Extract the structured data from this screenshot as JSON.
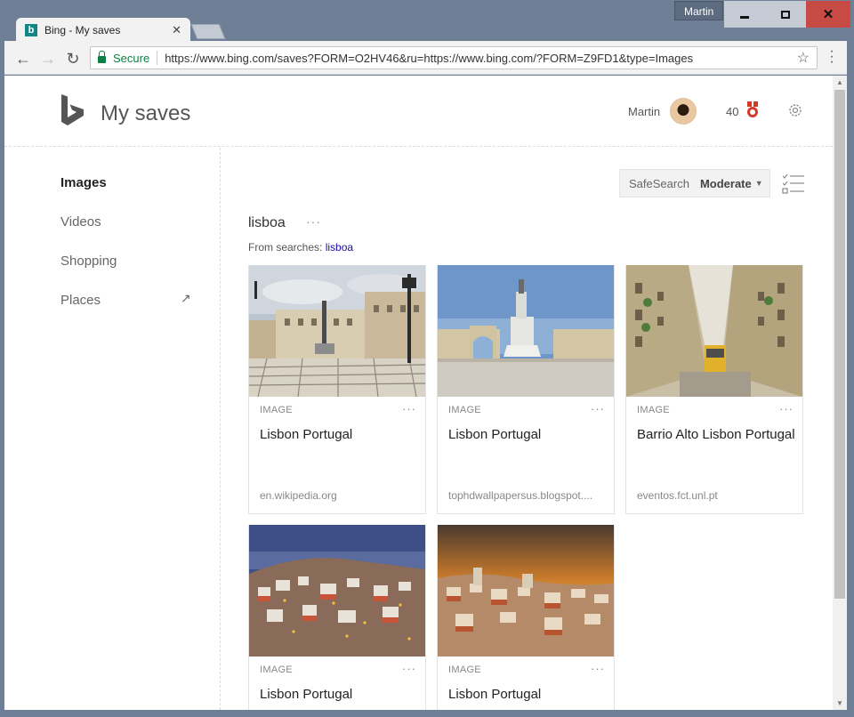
{
  "window": {
    "user_chip": "Martin"
  },
  "tab": {
    "title": "Bing - My saves",
    "favicon": "b"
  },
  "address_bar": {
    "secure_label": "Secure",
    "url": "https://www.bing.com/saves?FORM=O2HV46&ru=https://www.bing.com/?FORM=Z9FD1&type=Images"
  },
  "header": {
    "title": "My saves",
    "user_name": "Martin",
    "points": "40"
  },
  "sidebar": {
    "items": [
      {
        "label": "Images",
        "active": true
      },
      {
        "label": "Videos",
        "active": false
      },
      {
        "label": "Shopping",
        "active": false
      },
      {
        "label": "Places",
        "active": false
      }
    ]
  },
  "safesearch": {
    "label": "SafeSearch",
    "value": "Moderate"
  },
  "collection": {
    "title": "lisboa",
    "more": "···",
    "from_searches_label": "From searches:",
    "from_searches_link": "lisboa"
  },
  "cards": [
    {
      "type": "IMAGE",
      "title": "Lisbon Portugal",
      "source": "en.wikipedia.org"
    },
    {
      "type": "IMAGE",
      "title": "Lisbon Portugal",
      "source": "tophdwallpapersus.blogspot...."
    },
    {
      "type": "IMAGE",
      "title": "Barrio Alto Lisbon Portugal",
      "source": "eventos.fct.unl.pt"
    },
    {
      "type": "IMAGE",
      "title": "Lisbon Portugal",
      "source": ""
    },
    {
      "type": "IMAGE",
      "title": "Lisbon Portugal",
      "source": ""
    }
  ],
  "colors": {
    "bing_teal": "#138589",
    "secure_green": "#0b8043",
    "link_blue": "#1a0dab",
    "close_red": "#c84a44",
    "medal_red": "#d13b2a"
  }
}
